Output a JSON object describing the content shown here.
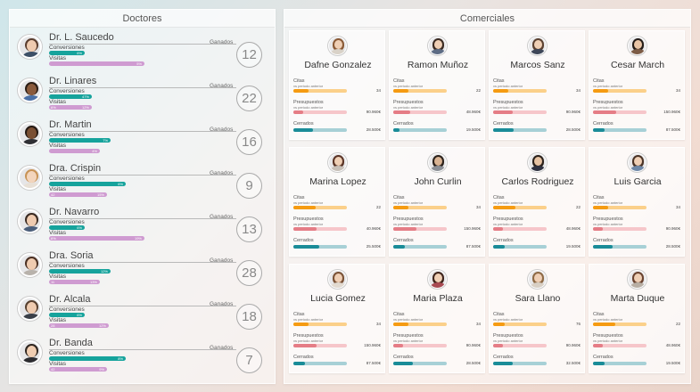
{
  "doctores": {
    "title": "Doctores",
    "ganados_label": "Ganados",
    "conversiones_label": "Conversiones",
    "visitas_label": "Visitas",
    "items": [
      {
        "name": "Dr. L. Saucedo",
        "count": "12",
        "conv_left": "",
        "conv_val": "6%",
        "vis_left": "",
        "vis_val": "5%",
        "conv_frac": 0.19,
        "vis_frac": 0.51,
        "skin": "#efcbb0",
        "hair": "#5a3d2e",
        "shirt": "#3d4f66"
      },
      {
        "name": "Dr. Linares",
        "count": "22",
        "conv_left": "",
        "conv_val": "47%",
        "vis_left": "6%",
        "vis_val": "12%",
        "conv_frac": 0.23,
        "vis_frac": 0.23,
        "skin": "#8a5a3c",
        "hair": "#2b1d15",
        "shirt": "#4a6fa5"
      },
      {
        "name": "Dr. Martin",
        "count": "16",
        "conv_left": "",
        "conv_val": "7%",
        "vis_left": "",
        "vis_val": "4%",
        "conv_frac": 0.33,
        "vis_frac": 0.27,
        "skin": "#7a4f33",
        "hair": "#241812",
        "shirt": "#2f2f34"
      },
      {
        "name": "Dra. Crispin",
        "count": "9",
        "conv_left": "",
        "conv_val": "6%",
        "vis_left": "42",
        "vis_val": "15%",
        "conv_frac": 0.41,
        "vis_frac": 0.31,
        "skin": "#f3d5bd",
        "hair": "#c89356",
        "shirt": "#e8e0d6"
      },
      {
        "name": "Dr. Navarro",
        "count": "13",
        "conv_left": "",
        "conv_val": "6%",
        "vis_left": "6%",
        "vis_val": "19%",
        "conv_frac": 0.19,
        "vis_frac": 0.51,
        "skin": "#efcbb0",
        "hair": "#3a2a21",
        "shirt": "#4b5e7a"
      },
      {
        "name": "Dra. Soria",
        "count": "28",
        "conv_left": "",
        "conv_val": "12%",
        "vis_left": "11",
        "vis_val": "13%",
        "conv_frac": 0.33,
        "vis_frac": 0.27,
        "skin": "#efcbb0",
        "hair": "#4a2f22",
        "shirt": "#b8b2ab"
      },
      {
        "name": "Dr. Alcala",
        "count": "18",
        "conv_left": "",
        "conv_val": "6%",
        "vis_left": "28",
        "vis_val": "12%",
        "conv_frac": 0.19,
        "vis_frac": 0.32,
        "skin": "#efcbb0",
        "hair": "#57402f",
        "shirt": "#3a3f48"
      },
      {
        "name": "Dr. Banda",
        "count": "7",
        "conv_left": "",
        "conv_val": "8%",
        "vis_left": "42",
        "vis_val": "9%",
        "conv_frac": 0.41,
        "vis_frac": 0.31,
        "skin": "#f0cdb1",
        "hair": "#2f2620",
        "shirt": "#2c2c30"
      }
    ]
  },
  "comerciales": {
    "title": "Comerciales",
    "citas_label": "Citas",
    "vs_label": "vs periodo anterior",
    "presupuestos_label": "Presupuestos",
    "cerrados_label": "Cerrados",
    "items": [
      {
        "name": "Dafne Gonzalez",
        "citas": "34",
        "presupuestos": "90.960€",
        "cerrados": "28.500€",
        "cit_frac": 0.28,
        "pre_frac": 0.18,
        "cer_frac": 0.36,
        "hair": "#8a5a36",
        "skin": "#efcfb5",
        "shirt": "#d9d2c8"
      },
      {
        "name": "Ramon Muñoz",
        "citas": "22",
        "presupuestos": "48.960€",
        "cerrados": "19.500€",
        "cit_frac": 0.28,
        "pre_frac": 0.32,
        "cer_frac": 0.11,
        "hair": "#3a2a21",
        "skin": "#efcfb5",
        "shirt": "#5d6c84"
      },
      {
        "name": "Marcos Sanz",
        "citas": "34",
        "presupuestos": "90.960€",
        "cerrados": "28.500€",
        "cit_frac": 0.28,
        "pre_frac": 0.37,
        "cer_frac": 0.38,
        "hair": "#5a4030",
        "skin": "#efcfb5",
        "shirt": "#3d4658"
      },
      {
        "name": "Cesar March",
        "citas": "34",
        "presupuestos": "150.960€",
        "cerrados": "87.500€",
        "cit_frac": 0.28,
        "pre_frac": 0.44,
        "cer_frac": 0.22,
        "hair": "#241c17",
        "skin": "#e9c5a6",
        "shirt": "#7c5b45"
      },
      {
        "name": "Marina Lopez",
        "citas": "22",
        "presupuestos": "40.960€",
        "cerrados": "25.500€",
        "cit_frac": 0.41,
        "pre_frac": 0.44,
        "cer_frac": 0.48,
        "hair": "#5a3426",
        "skin": "#efcfb5",
        "shirt": "#c8c0b8"
      },
      {
        "name": "John Curlin",
        "citas": "34",
        "presupuestos": "150.960€",
        "cerrados": "87.500€",
        "cit_frac": 0.28,
        "pre_frac": 0.44,
        "cer_frac": 0.22,
        "hair": "#2b211b",
        "skin": "#d9b393",
        "shirt": "#8c8f96"
      },
      {
        "name": "Carlos Rodriguez",
        "citas": "22",
        "presupuestos": "48.960€",
        "cerrados": "19.500€",
        "cit_frac": 0.41,
        "pre_frac": 0.18,
        "cer_frac": 0.22,
        "hair": "#2b211b",
        "skin": "#e6c2a2",
        "shirt": "#2f3140"
      },
      {
        "name": "Luis Garcia",
        "citas": "34",
        "presupuestos": "90.960€",
        "cerrados": "28.500€",
        "cit_frac": 0.28,
        "pre_frac": 0.18,
        "cer_frac": 0.36,
        "hair": "#4a3326",
        "skin": "#efcfb5",
        "shirt": "#6e88a8"
      },
      {
        "name": "Lucia Gomez",
        "citas": "34",
        "presupuestos": "150.960€",
        "cerrados": "87.500€",
        "cit_frac": 0.28,
        "pre_frac": 0.44,
        "cer_frac": 0.22,
        "hair": "#7a5236",
        "skin": "#efcfb5",
        "shirt": "#e2dad0"
      },
      {
        "name": "Maria Plaza",
        "citas": "34",
        "presupuestos": "90.960€",
        "cerrados": "28.500€",
        "cit_frac": 0.28,
        "pre_frac": 0.18,
        "cer_frac": 0.36,
        "hair": "#3e241b",
        "skin": "#efcfb5",
        "shirt": "#a84a52"
      },
      {
        "name": "Sara Llano",
        "citas": "76",
        "presupuestos": "90.960€",
        "cerrados": "32.500€",
        "cit_frac": 0.22,
        "pre_frac": 0.18,
        "cer_frac": 0.36,
        "hair": "#8e6a45",
        "skin": "#efcfb5",
        "shirt": "#d8cfc4"
      },
      {
        "name": "Marta Duque",
        "citas": "22",
        "presupuestos": "48.960€",
        "cerrados": "19.500€",
        "cit_frac": 0.41,
        "pre_frac": 0.18,
        "cer_frac": 0.22,
        "hair": "#6a4330",
        "skin": "#efcfb5",
        "shirt": "#b8aea3"
      }
    ]
  }
}
